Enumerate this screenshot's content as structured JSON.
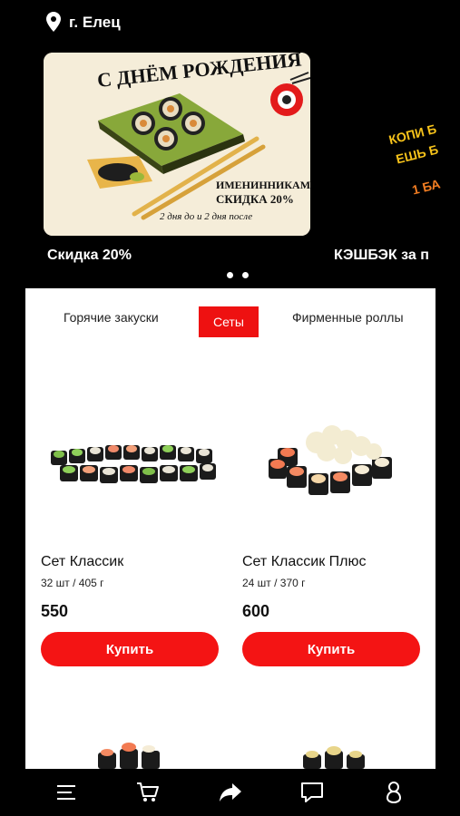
{
  "header": {
    "city": "г. Елец",
    "pin_icon": "location-pin-icon"
  },
  "promos": [
    {
      "title": "Скидка 20%",
      "banner": {
        "heading": "С ДНЁМ РОЖДЕНИЯ",
        "line1": "ИМЕНИННИКАМ",
        "line2": "СКИДКА 20%",
        "line3": "2 дня до и 2 дня после"
      }
    },
    {
      "title": "КЭШБЭК за п",
      "banner": {
        "line1": "КОПИ Б",
        "line2": "ЕШЬ Б",
        "line3": "1 БА"
      }
    }
  ],
  "carousel": {
    "dots": 2,
    "active": 0
  },
  "tabs": [
    {
      "label": "Горячие закуски",
      "active": false
    },
    {
      "label": "Сеты",
      "active": true
    },
    {
      "label": "Фирменные роллы",
      "active": false
    }
  ],
  "products": [
    {
      "name": "Сет Классик",
      "weight": "32 шт / 405 г",
      "price": "550",
      "button": "Купить"
    },
    {
      "name": "Сет Классик Плюс",
      "weight": "24 шт / 370 г",
      "price": "600",
      "button": "Купить"
    }
  ],
  "nav": [
    {
      "icon": "menu-icon"
    },
    {
      "icon": "cart-icon"
    },
    {
      "icon": "share-icon"
    },
    {
      "icon": "chat-icon"
    },
    {
      "icon": "profile-icon"
    }
  ],
  "colors": {
    "accent": "#f41414",
    "background": "#000000",
    "panel": "#ffffff",
    "banner_bg": "#f5edd9"
  }
}
